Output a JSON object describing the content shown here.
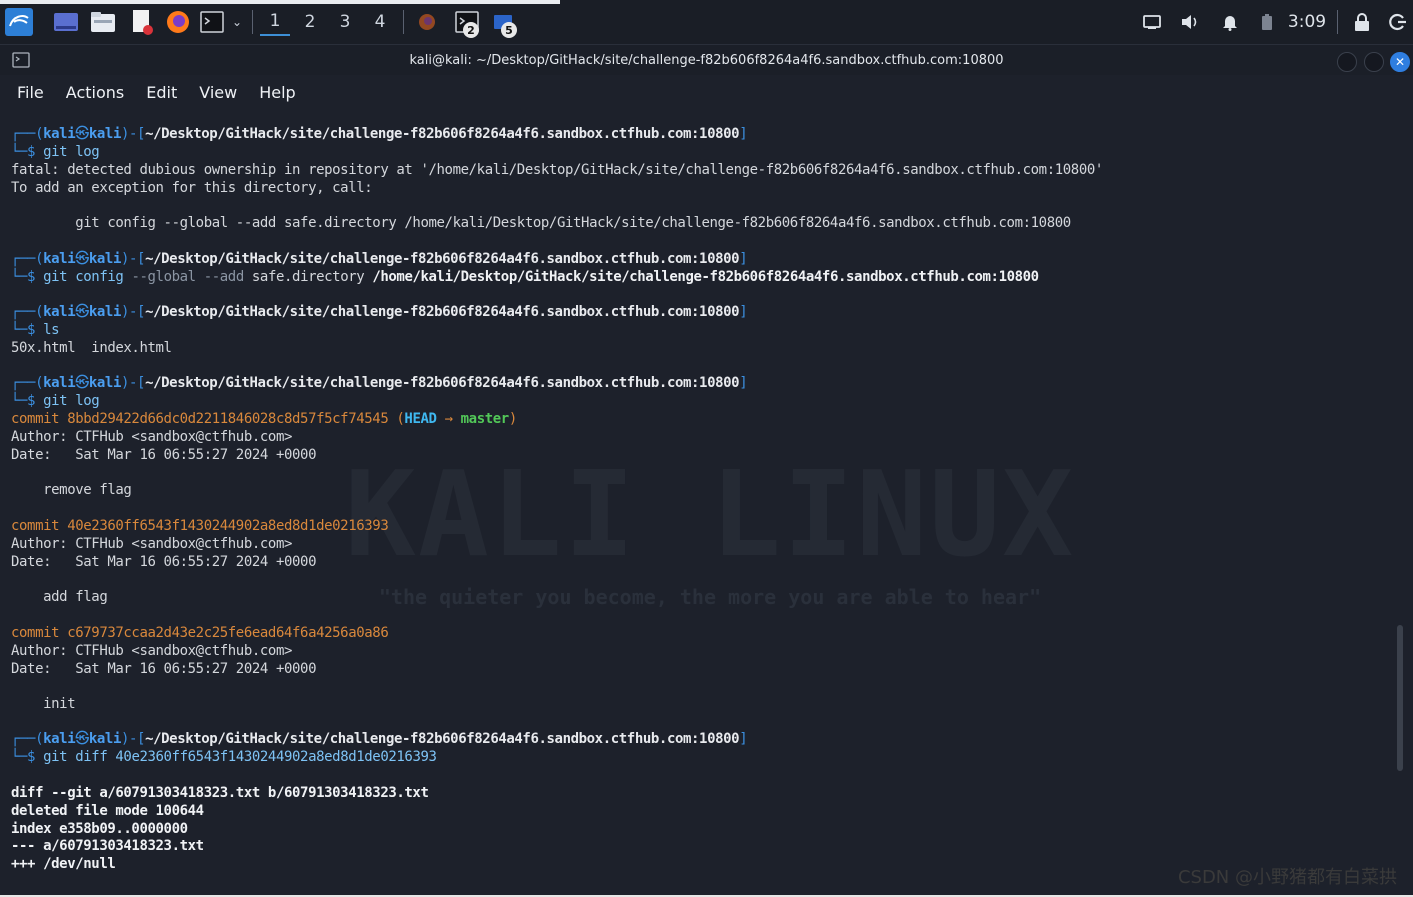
{
  "taskbar": {
    "workspaces": [
      "1",
      "2",
      "3",
      "4"
    ],
    "active_workspace": "1",
    "terminal_badge": "2",
    "app_badge": "5",
    "time": "3:09"
  },
  "window": {
    "title": "kali@kali: ~/Desktop/GitHack/site/challenge-f82b606f8264a4f6.sandbox.ctfhub.com:10800",
    "close_glyph": "✕"
  },
  "menu": [
    "File",
    "Actions",
    "Edit",
    "View",
    "Help"
  ],
  "prompt": {
    "open": "┌──(",
    "user": "kali",
    "at": "㉿",
    "host": "kali",
    "mid": ")-[",
    "path": "~/Desktop/GitHack/site/challenge-f82b606f8264a4f6.sandbox.ctfhub.com:10800",
    "close": "]",
    "dollar": "└─$ "
  },
  "terminal": {
    "cmd1": "git log",
    "err1": "fatal: detected dubious ownership in repository at '/home/kali/Desktop/GitHack/site/challenge-f82b606f8264a4f6.sandbox.ctfhub.com:10800'",
    "err2": "To add an exception for this directory, call:",
    "err3": "        git config --global --add safe.directory /home/kali/Desktop/GitHack/site/challenge-f82b606f8264a4f6.sandbox.ctfhub.com:10800",
    "cmd2_a": "git config ",
    "cmd2_b": "--global --add ",
    "cmd2_c": "safe.directory ",
    "cmd2_d": "/home/kali/Desktop/GitHack/site/challenge-f82b606f8264a4f6.sandbox.ctfhub.com:10800",
    "cmd3": "ls",
    "ls_out": "50x.html  index.html",
    "cmd4": "git log",
    "c1_hash": "commit 8bbd29422d66dc0d2211846028c8d57f5cf74545 (",
    "c1_head": "HEAD",
    "c1_arrow": " → ",
    "c1_master": "master",
    "c1_close": ")",
    "author": "Author: CTFHub <sandbox@ctfhub.com>",
    "date": "Date:   Sat Mar 16 06:55:27 2024 +0000",
    "c1_msg": "    remove flag",
    "c2_hash": "commit 40e2360ff6543f1430244902a8ed8d1de0216393",
    "c2_msg": "    add flag",
    "c3_hash": "commit c679737ccaa2d43e2c25fe6ead64f6a4256a0a86",
    "c3_msg": "    init",
    "cmd5": "git diff 40e2360ff6543f1430244902a8ed8d1de0216393",
    "diff1": "diff --git a/60791303418323.txt b/60791303418323.txt",
    "diff2": "deleted file mode 100644",
    "diff3": "index e358b09..0000000",
    "diff4": "--- a/60791303418323.txt",
    "diff5": "+++ /dev/null"
  },
  "watermark": {
    "title": "KALI LINUX",
    "quote": "\"the quieter you become, the more you are able to hear\""
  },
  "footer": "CSDN @小野猪都有白菜拱"
}
